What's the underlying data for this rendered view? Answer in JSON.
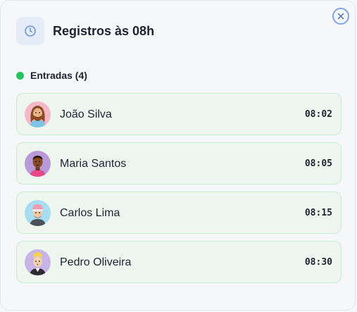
{
  "modal": {
    "title": "Registros às 08h",
    "header_icon": "clock-icon",
    "close_icon": "close-icon",
    "accent_color": "#7ea6e6"
  },
  "section": {
    "label": "Entradas (4)",
    "status_color": "#22c55e"
  },
  "entries": [
    {
      "name": "João Silva",
      "time": "08:02",
      "avatar": "avatar-long-hair-beard"
    },
    {
      "name": "Maria Santos",
      "time": "08:05",
      "avatar": "avatar-dark-skin"
    },
    {
      "name": "Carlos Lima",
      "time": "08:15",
      "avatar": "avatar-pink-cap"
    },
    {
      "name": "Pedro Oliveira",
      "time": "08:30",
      "avatar": "avatar-blond"
    }
  ]
}
